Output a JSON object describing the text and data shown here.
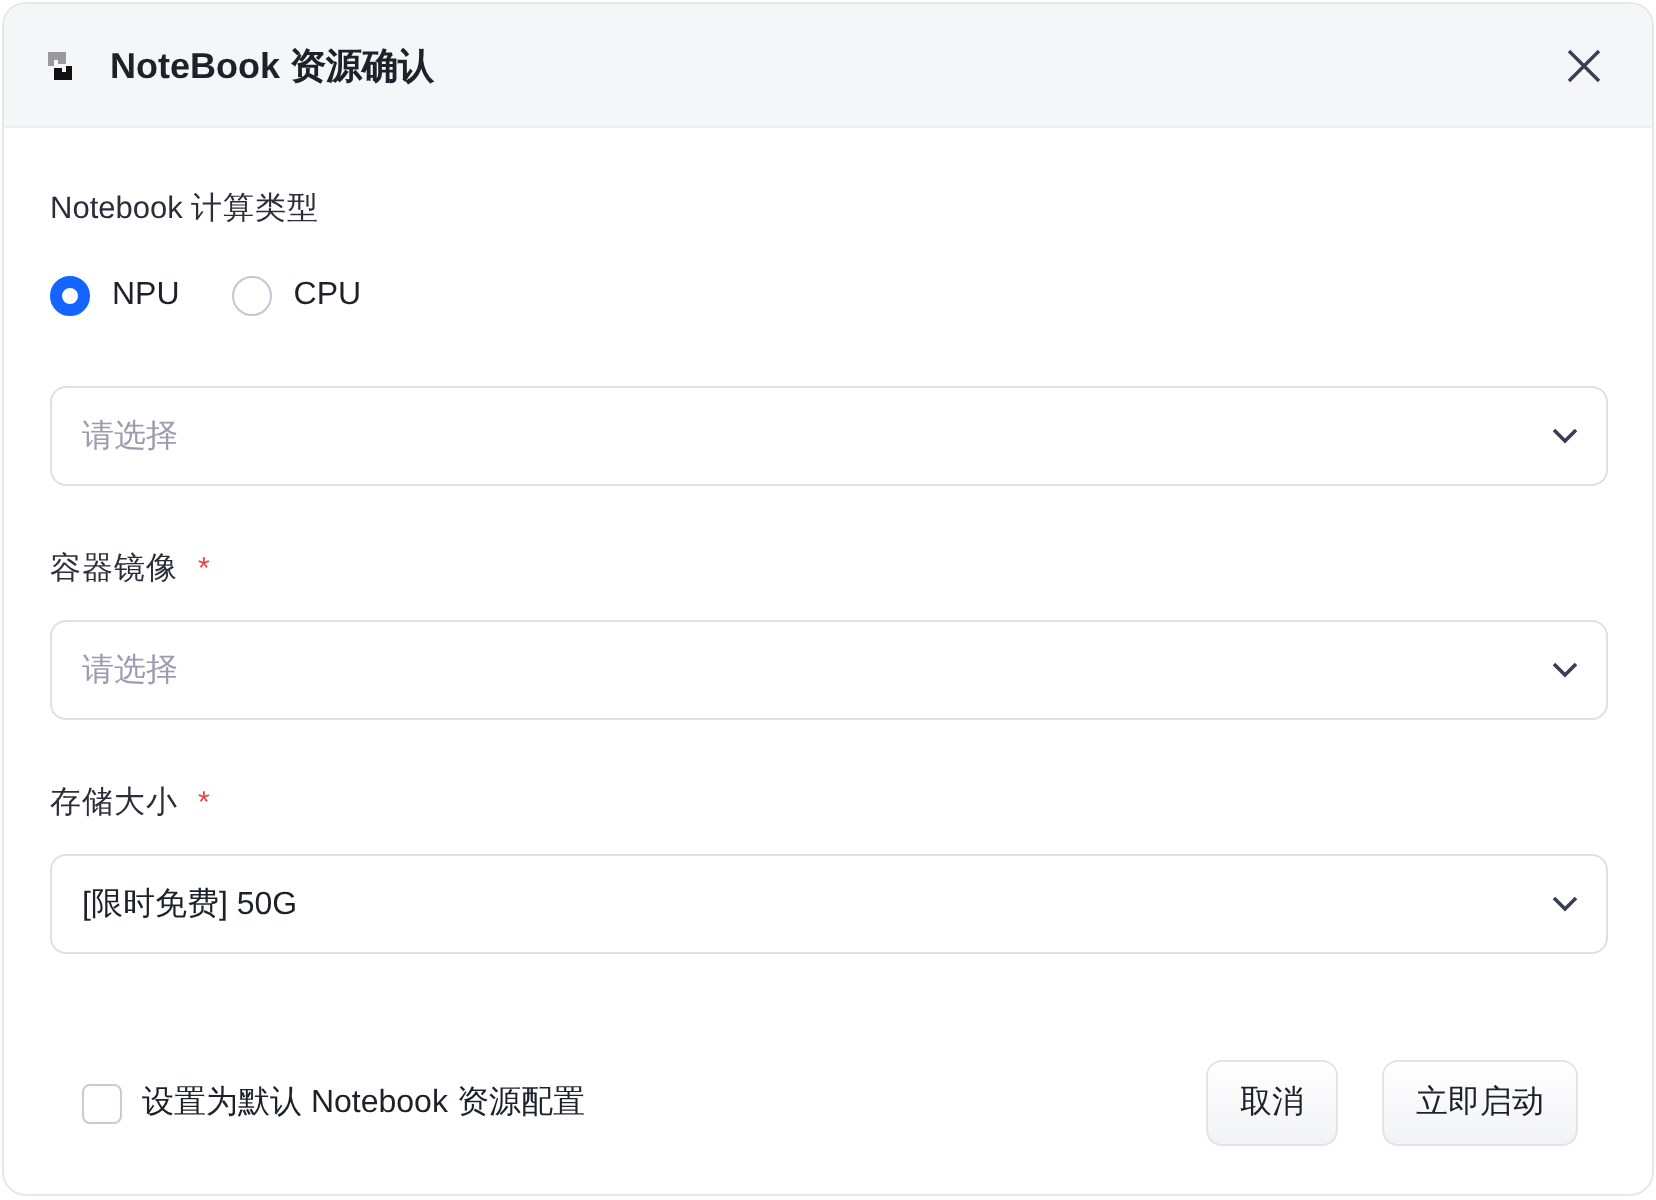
{
  "dialog": {
    "title": "NoteBook 资源确认"
  },
  "compute_type": {
    "label": "Notebook 计算类型",
    "options": [
      {
        "label": "NPU",
        "selected": true
      },
      {
        "label": "CPU",
        "selected": false
      }
    ]
  },
  "fields": [
    {
      "placeholder": "请选择"
    },
    {
      "label": "容器镜像",
      "required_mark": "*",
      "placeholder": "请选择"
    },
    {
      "label": "存储大小",
      "required_mark": "*",
      "value": "[限时免费] 50G"
    }
  ],
  "footer": {
    "default_checkbox": {
      "label": "设置为默认 Notebook 资源配置",
      "checked": false
    },
    "buttons": [
      "取消",
      "立即启动"
    ]
  }
}
